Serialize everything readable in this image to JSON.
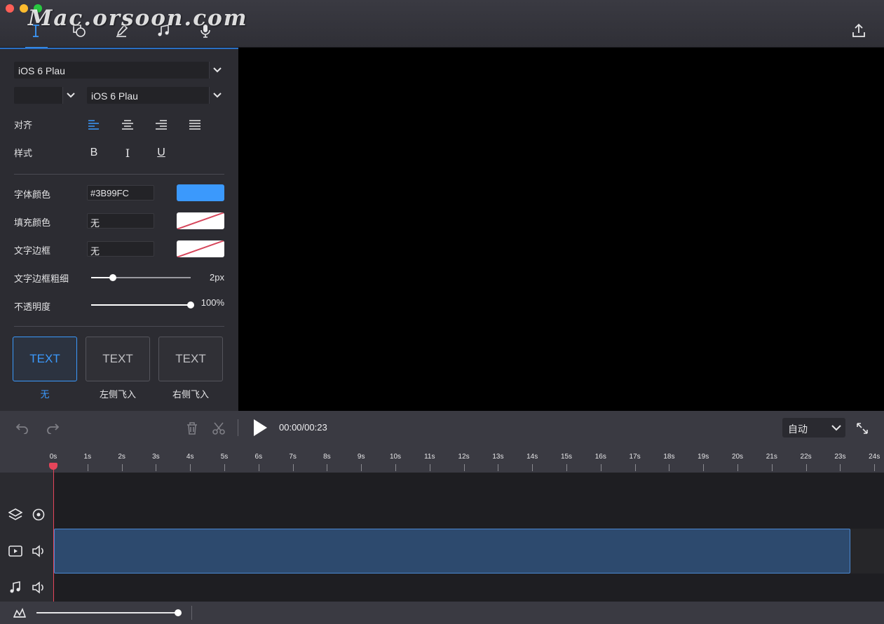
{
  "watermark": "Mac.orsoon.com",
  "toolbar": {
    "tabs": [
      {
        "icon": "text-cursor-icon"
      },
      {
        "icon": "shapes-icon"
      },
      {
        "icon": "brush-icon"
      },
      {
        "icon": "music-note-icon"
      },
      {
        "icon": "microphone-icon"
      }
    ],
    "export_icon": "share-export-icon"
  },
  "text_panel": {
    "font_family": "iOS 6 Plau",
    "font_size": "",
    "font_variant": "iOS 6 Plau",
    "align_label": "对齐",
    "style_label": "样式",
    "style_buttons": [
      "B",
      "I",
      "U"
    ],
    "font_color_label": "字体颜色",
    "font_color_value": "#3B99FC",
    "font_color_swatch": "#3B99FC",
    "fill_color_label": "填充颜色",
    "fill_color_value": "无",
    "stroke_label": "文字边框",
    "stroke_value": "无",
    "stroke_width_label": "文字边框粗细",
    "stroke_width_value": "2px",
    "stroke_width_fraction": 0.22,
    "opacity_label": "不透明度",
    "opacity_value": "100%",
    "opacity_fraction": 1.0,
    "presets": [
      {
        "text": "TEXT",
        "label": "无"
      },
      {
        "text": "TEXT",
        "label": "左侧飞入"
      },
      {
        "text": "TEXT",
        "label": "右侧飞入"
      }
    ]
  },
  "transport": {
    "time": "00:00/00:23",
    "speed": "自动"
  },
  "timeline": {
    "ticks": [
      "0s",
      "1s",
      "2s",
      "3s",
      "4s",
      "5s",
      "6s",
      "7s",
      "8s",
      "9s",
      "10s",
      "11s",
      "12s",
      "13s",
      "14s",
      "15s",
      "16s",
      "17s",
      "18s",
      "19s",
      "20s",
      "21s",
      "22s",
      "23s",
      "24s"
    ],
    "zoom_fraction": 1.0
  },
  "colors": {
    "accent": "#3B99FC",
    "playhead": "#E6455A",
    "clip": "#2D4A6E"
  }
}
